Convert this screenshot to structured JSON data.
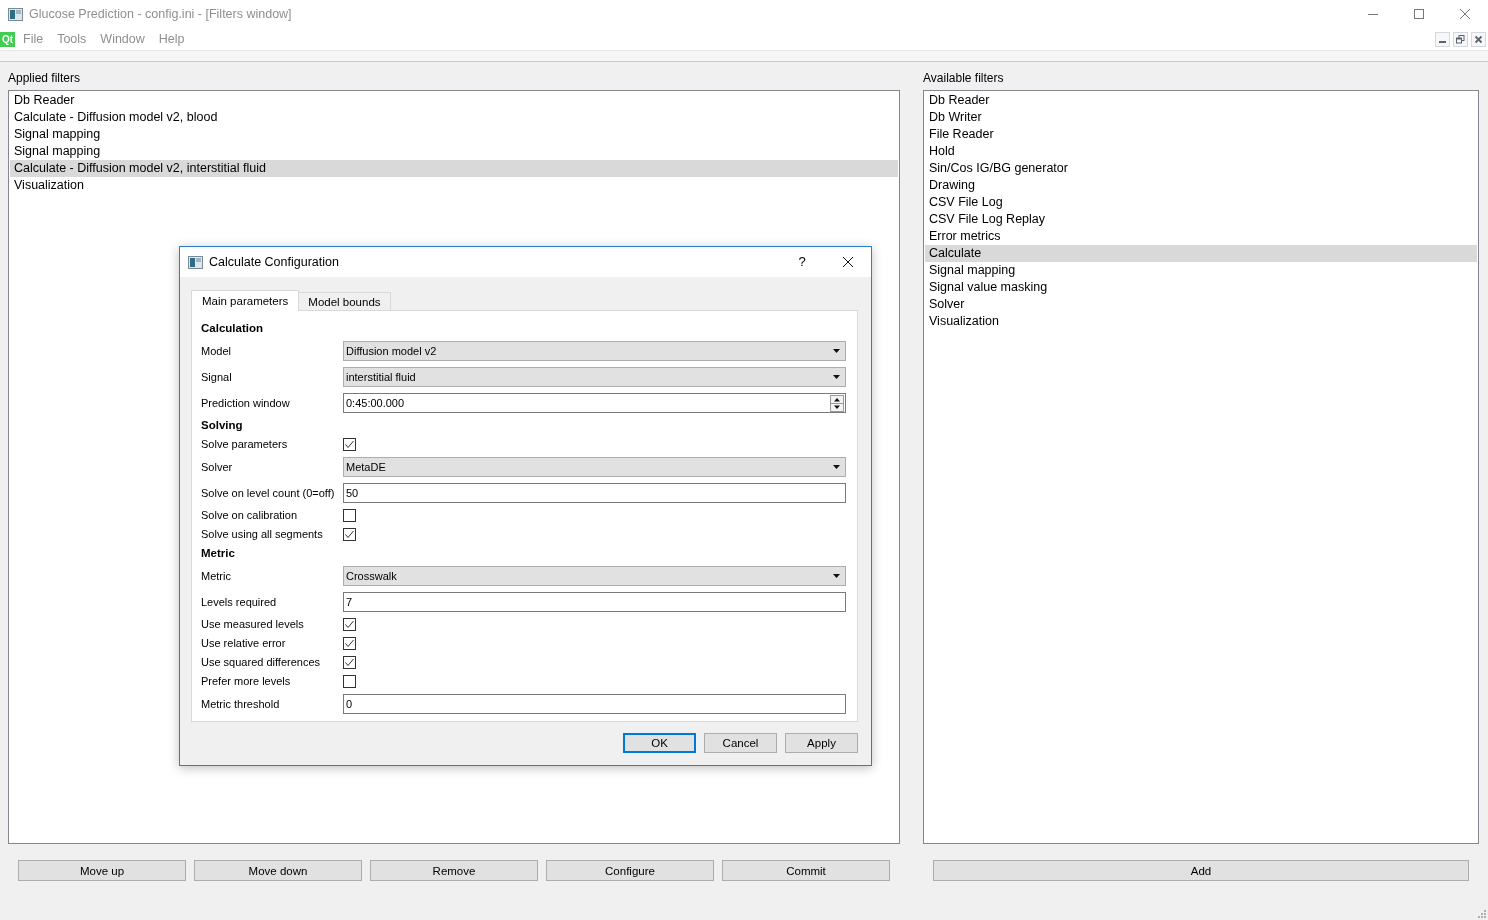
{
  "window": {
    "title": "Glucose Prediction - config.ini - [Filters window]",
    "active": false
  },
  "menu_bar": {
    "logo": "Qt",
    "items": [
      "File",
      "Tools",
      "Window",
      "Help"
    ]
  },
  "applied_filters": {
    "label": "Applied filters",
    "items": [
      {
        "label": "Db Reader",
        "selected": false
      },
      {
        "label": "Calculate - Diffusion model v2, blood",
        "selected": false
      },
      {
        "label": "Signal mapping",
        "selected": false
      },
      {
        "label": "Signal mapping",
        "selected": false
      },
      {
        "label": "Calculate - Diffusion model v2, interstitial fluid",
        "selected": true
      },
      {
        "label": "Visualization",
        "selected": false
      }
    ]
  },
  "available_filters": {
    "label": "Available filters",
    "items": [
      {
        "label": "Db Reader",
        "selected": false
      },
      {
        "label": "Db Writer",
        "selected": false
      },
      {
        "label": "File Reader",
        "selected": false
      },
      {
        "label": "Hold",
        "selected": false
      },
      {
        "label": "Sin/Cos IG/BG generator",
        "selected": false
      },
      {
        "label": "Drawing",
        "selected": false
      },
      {
        "label": "CSV File Log",
        "selected": false
      },
      {
        "label": "CSV File Log Replay",
        "selected": false
      },
      {
        "label": "Error metrics",
        "selected": false
      },
      {
        "label": "Calculate",
        "selected": true
      },
      {
        "label": "Signal mapping",
        "selected": false
      },
      {
        "label": "Signal value masking",
        "selected": false
      },
      {
        "label": "Solver",
        "selected": false
      },
      {
        "label": "Visualization",
        "selected": false
      }
    ]
  },
  "applied_buttons": [
    "Move up",
    "Move down",
    "Remove",
    "Configure",
    "Commit"
  ],
  "available_buttons": [
    "Add"
  ],
  "dialog": {
    "title": "Calculate Configuration",
    "help": "?",
    "tabs": [
      {
        "label": "Main parameters",
        "selected": true
      },
      {
        "label": "Model bounds",
        "selected": false
      }
    ],
    "rows": [
      {
        "kind": "header",
        "label": "Calculation"
      },
      {
        "kind": "combo",
        "label": "Model",
        "value": "Diffusion model v2"
      },
      {
        "kind": "combo",
        "label": "Signal",
        "value": "interstitial fluid"
      },
      {
        "kind": "spin",
        "label": "Prediction window",
        "value": "0:45:00.000"
      },
      {
        "kind": "header",
        "label": "Solving"
      },
      {
        "kind": "check",
        "label": "Solve parameters",
        "checked": true
      },
      {
        "kind": "combo",
        "label": "Solver",
        "value": "MetaDE"
      },
      {
        "kind": "input",
        "label": "Solve on level count (0=off)",
        "value": "50"
      },
      {
        "kind": "check",
        "label": "Solve on calibration",
        "checked": false
      },
      {
        "kind": "check",
        "label": "Solve using all segments",
        "checked": true
      },
      {
        "kind": "header",
        "label": "Metric"
      },
      {
        "kind": "combo",
        "label": "Metric",
        "value": "Crosswalk"
      },
      {
        "kind": "input",
        "label": "Levels required",
        "value": "7"
      },
      {
        "kind": "check",
        "label": "Use measured levels",
        "checked": true
      },
      {
        "kind": "check",
        "label": "Use relative error",
        "checked": true
      },
      {
        "kind": "check",
        "label": "Use squared differences",
        "checked": true
      },
      {
        "kind": "check",
        "label": "Prefer more levels",
        "checked": false
      },
      {
        "kind": "input",
        "label": "Metric threshold",
        "value": "0"
      }
    ],
    "buttons": [
      {
        "label": "OK",
        "default": true
      },
      {
        "label": "Cancel",
        "default": false
      },
      {
        "label": "Apply",
        "default": false
      }
    ]
  }
}
